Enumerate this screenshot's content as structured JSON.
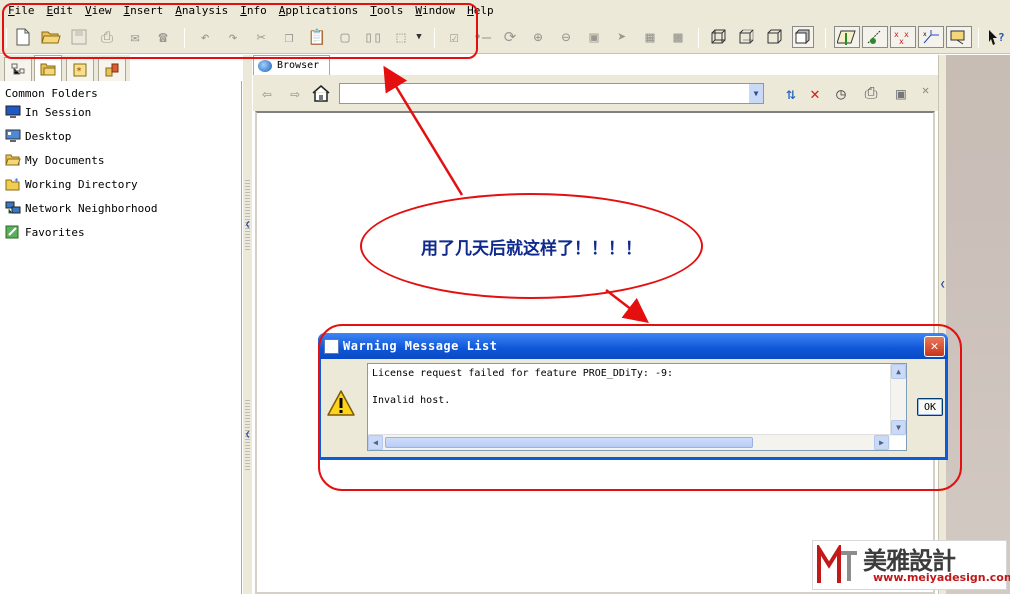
{
  "menu": [
    "File",
    "Edit",
    "View",
    "Insert",
    "Analysis",
    "Info",
    "Applications",
    "Tools",
    "Window",
    "Help"
  ],
  "left_panel": {
    "header": "Common Folders",
    "items": [
      {
        "label": "In Session",
        "icon": "monitor-icon"
      },
      {
        "label": "Desktop",
        "icon": "desktop-icon"
      },
      {
        "label": "My Documents",
        "icon": "folder-open-icon"
      },
      {
        "label": "Working Directory",
        "icon": "folder-star-icon"
      },
      {
        "label": "Network Neighborhood",
        "icon": "network-icon"
      },
      {
        "label": "Favorites",
        "icon": "favorites-icon"
      }
    ]
  },
  "browser": {
    "tab_label": "Browser",
    "url_value": ""
  },
  "callout": {
    "text": "用了几天后就这样了！！！！"
  },
  "dialog": {
    "title": "Warning Message List",
    "messages": [
      "License request failed for feature PROE_DDiTy: -9:",
      "Invalid host."
    ],
    "ok_label": "OK"
  },
  "watermark": {
    "brand": "美雅設計",
    "url": "www.meiyadesign.com"
  },
  "colors": {
    "annotation_red": "#e41010",
    "callout_text": "#0f2a8c",
    "xp_title_blue": "#0e56d8",
    "toolbar_bg": "#ece9d8"
  }
}
